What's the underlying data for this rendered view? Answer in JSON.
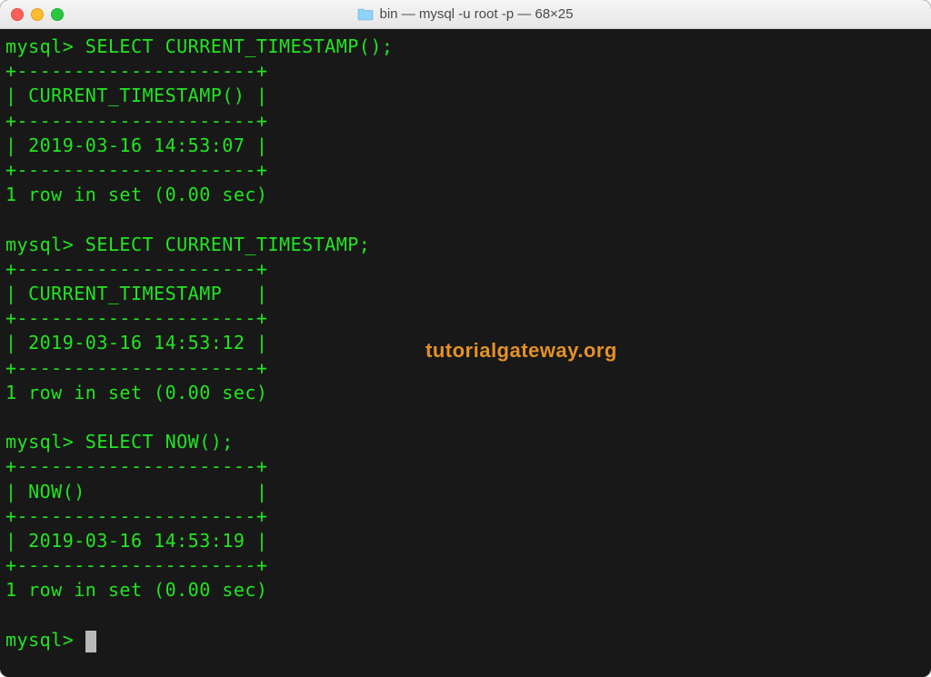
{
  "window": {
    "title": "bin — mysql -u root -p — 68×25",
    "folder_label": "bin",
    "full_command": "mysql -u root -p",
    "size": "68×25"
  },
  "colors": {
    "text": "#21e521",
    "background": "#181818",
    "watermark": "#e59125"
  },
  "watermark": "tutorialgateway.org",
  "prompt": "mysql>",
  "queries": [
    {
      "sql": "SELECT CURRENT_TIMESTAMP();",
      "border": "+---------------------+",
      "header_row": "| CURRENT_TIMESTAMP() |",
      "value_row": "| 2019-03-16 14:53:07 |",
      "column_name": "CURRENT_TIMESTAMP()",
      "value": "2019-03-16 14:53:07",
      "status": "1 row in set (0.00 sec)"
    },
    {
      "sql": "SELECT CURRENT_TIMESTAMP;",
      "border": "+---------------------+",
      "header_row": "| CURRENT_TIMESTAMP   |",
      "value_row": "| 2019-03-16 14:53:12 |",
      "column_name": "CURRENT_TIMESTAMP",
      "value": "2019-03-16 14:53:12",
      "status": "1 row in set (0.00 sec)"
    },
    {
      "sql": "SELECT NOW();",
      "border": "+---------------------+",
      "header_row": "| NOW()               |",
      "value_row": "| 2019-03-16 14:53:19 |",
      "column_name": "NOW()",
      "value": "2019-03-16 14:53:19",
      "status": "1 row in set (0.00 sec)"
    }
  ]
}
